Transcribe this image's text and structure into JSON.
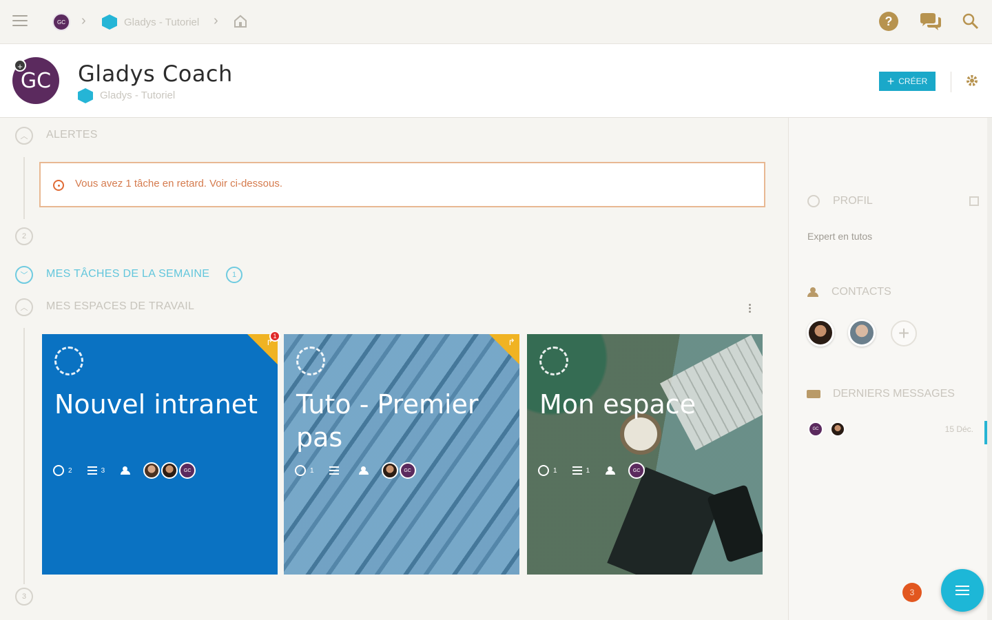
{
  "breadcrumb": {
    "user_initials": "GC",
    "space_label": "Gladys - Tutoriel"
  },
  "header": {
    "avatar_initials": "GC",
    "title": "Gladys Coach",
    "subtitle": "Gladys - Tutoriel",
    "create_label": "CRÉER"
  },
  "sections": {
    "alerts_label": "ALERTES",
    "alert_message": "Vous avez 1 tâche en retard. Voir ci-dessous.",
    "alerts_count": "2",
    "tasks_label": "MES TÂCHES DE LA SEMAINE",
    "tasks_count": "1",
    "workspaces_label": "MES ESPACES DE TRAVAIL",
    "bottom_count": "3"
  },
  "cards": [
    {
      "title": "Nouvel intranet",
      "tasks": "2",
      "lists": "3",
      "badge": "1",
      "member_initials": "GC"
    },
    {
      "title": "Tuto - Premier pas",
      "tasks": "1",
      "lists": "",
      "member_initials": "GC"
    },
    {
      "title": "Mon espace",
      "tasks": "1",
      "lists": "1",
      "member_initials": "GC"
    }
  ],
  "sidebar": {
    "profile_label": "PROFIL",
    "profile_text": "Expert en tutos",
    "contacts_label": "CONTACTS",
    "messages_label": "DERNIERS MESSAGES",
    "message_initials": "GC",
    "message_date": "15 Déc."
  },
  "footer": {
    "notification_count": "3"
  },
  "colors": {
    "brand_teal": "#1db7d7",
    "avatar_purple": "#5b2a5e",
    "alert_orange": "#e06a34",
    "card_blue": "#0a72c2",
    "tag_yellow": "#f0b323"
  },
  "icons": {
    "menu": "hamburger-icon",
    "help": "question-icon",
    "chat": "chat-bubbles-icon",
    "search": "search-icon",
    "home": "home-icon",
    "settings": "gear-icon"
  }
}
